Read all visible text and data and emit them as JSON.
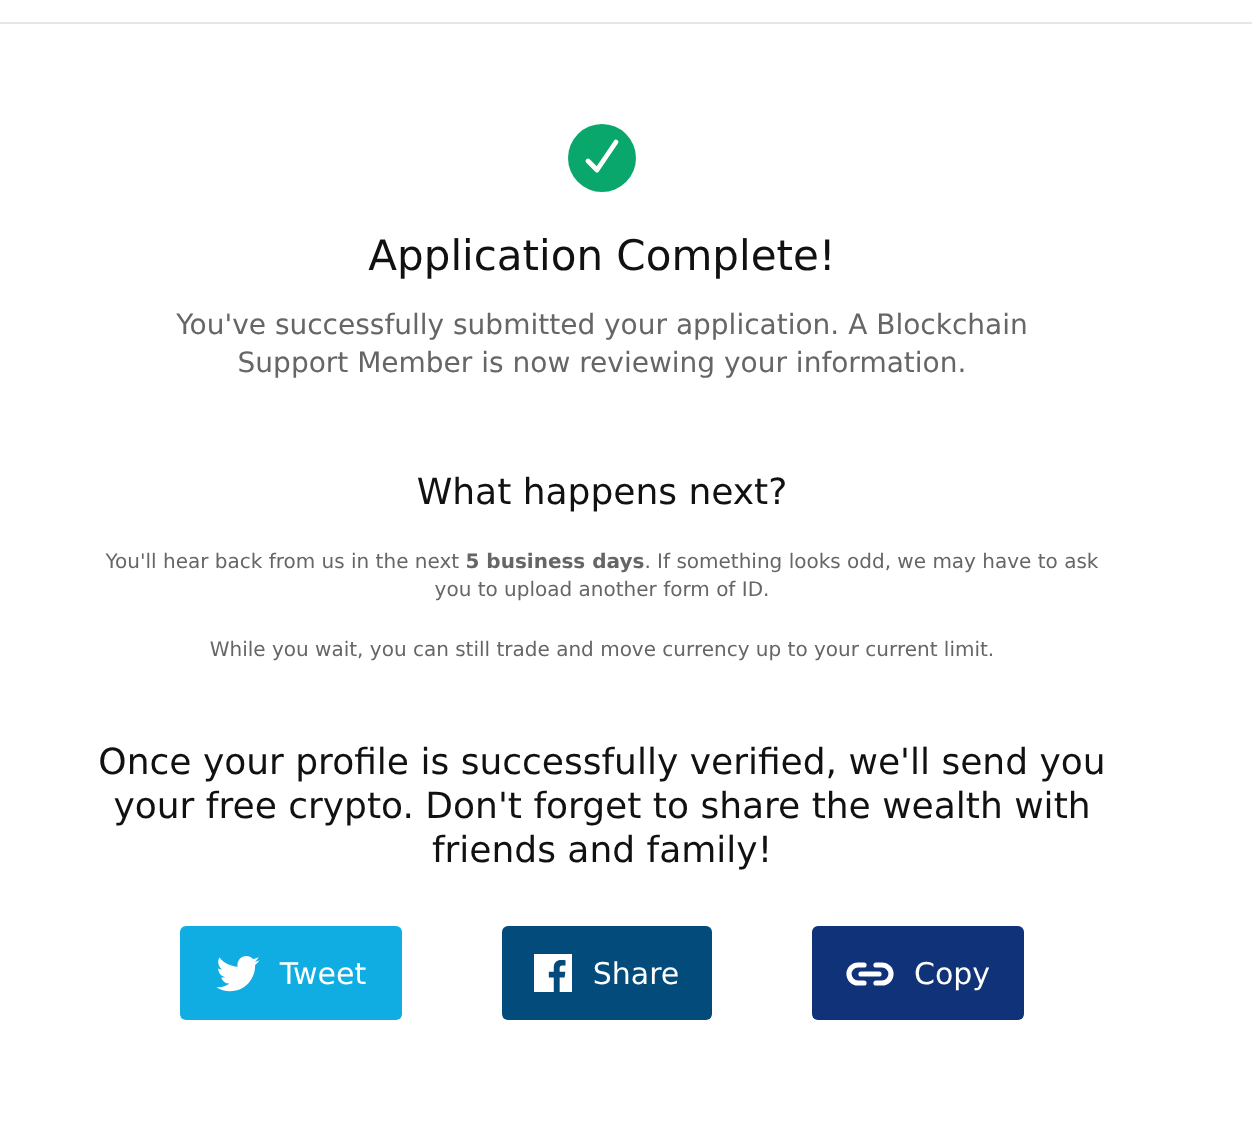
{
  "title": "Application Complete!",
  "intro": "You've successfully submitted your application. A Blockchain Support Member is now reviewing your information.",
  "next": {
    "heading": "What happens next?",
    "paragraphs": [
      "You'll hear back from us in the next **5 business days**. If something looks odd, we may have to ask you to upload another form of ID.",
      "While you wait, you can still trade and move currency up to your current limit."
    ]
  },
  "share_message": "Once your profile is successfully verified, we'll send you your free crypto. Don't forget to share the wealth with friends and family!",
  "buttons": [
    {
      "kind": "twitter",
      "label": "Tweet",
      "color": "#10ade3"
    },
    {
      "kind": "facebook",
      "label": "Share",
      "color": "#034b7b"
    },
    {
      "kind": "link",
      "label": "Copy",
      "color": "#0f3278"
    }
  ]
}
